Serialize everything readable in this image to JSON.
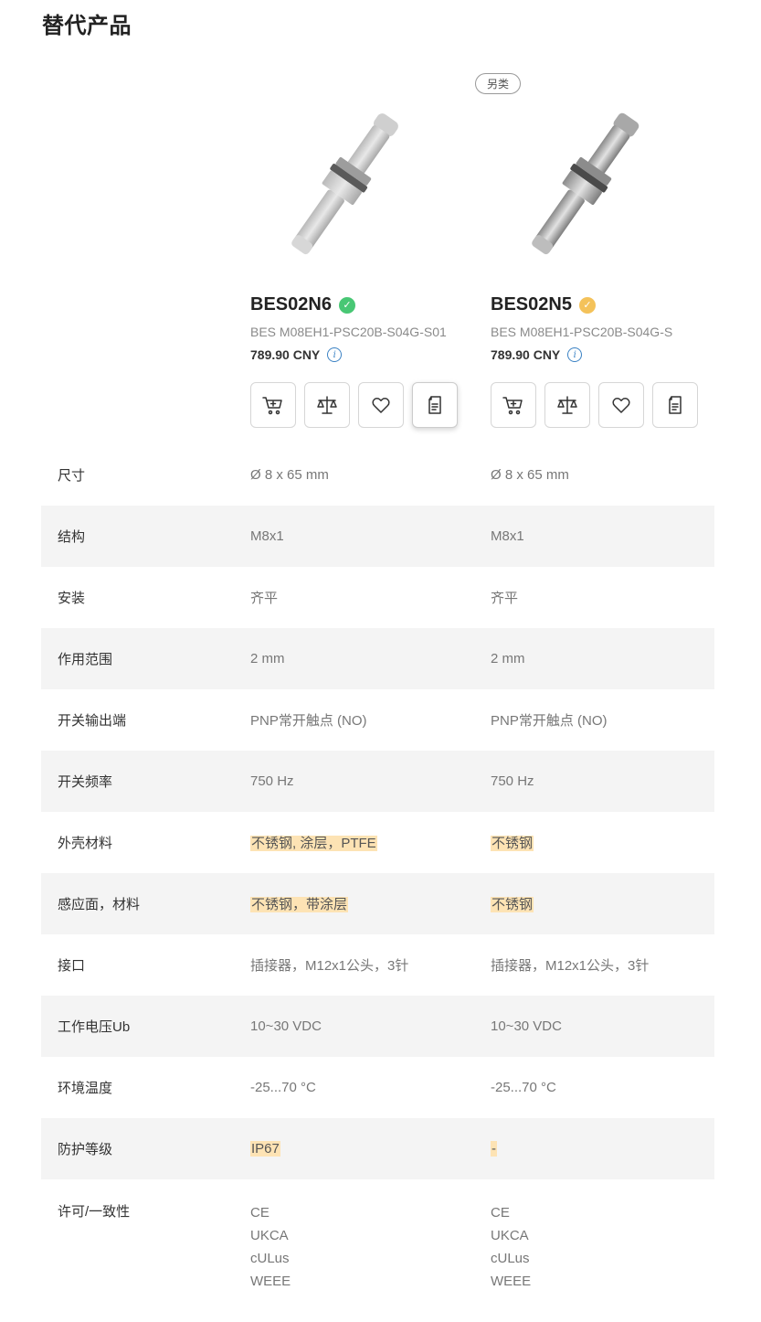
{
  "section_title": "替代产品",
  "products": [
    {
      "badge": "",
      "name": "BES02N6",
      "code": "BES M08EH1-PSC20B-S04G-S01",
      "price": "789.90 CNY",
      "check_color": "green"
    },
    {
      "badge": "另类",
      "name": "BES02N5",
      "code": "BES M08EH1-PSC20B-S04G-S",
      "price": "789.90 CNY",
      "check_color": "amber"
    }
  ],
  "icons": {
    "check": "check-circle-icon",
    "info": "info-icon",
    "cart": "cart-icon",
    "compare": "scale-icon",
    "favorite": "heart-icon",
    "datasheet": "document-icon"
  },
  "colors": {
    "highlight": "#fde3b4",
    "row_alt": "#f4f4f4",
    "check_green": "#48c774",
    "check_amber": "#f4c25a",
    "info_blue": "#3b82c4"
  },
  "specs": [
    {
      "label": "尺寸",
      "v1": "Ø 8 x 65 mm",
      "v2": "Ø 8 x 65 mm"
    },
    {
      "label": "结构",
      "v1": "M8x1",
      "v2": "M8x1"
    },
    {
      "label": "安装",
      "v1": "齐平",
      "v2": "齐平"
    },
    {
      "label": "作用范围",
      "v1": "2 mm",
      "v2": "2 mm"
    },
    {
      "label": "开关输出端",
      "v1": "PNP常开触点 (NO)",
      "v2": "PNP常开触点 (NO)"
    },
    {
      "label": "开关频率",
      "v1": "750 Hz",
      "v2": "750 Hz"
    },
    {
      "label": "外壳材料",
      "v1": "不锈钢, 涂层，PTFE",
      "v2": "不锈钢"
    },
    {
      "label": "感应面，材料",
      "v1": "不锈钢，带涂层",
      "v2": "不锈钢"
    },
    {
      "label": "接口",
      "v1": "插接器，M12x1公头，3针",
      "v2": "插接器，M12x1公头，3针"
    },
    {
      "label": "工作电压Ub",
      "v1": "10~30 VDC",
      "v2": "10~30 VDC"
    },
    {
      "label": "环境温度",
      "v1": "-25...70 °C",
      "v2": "-25...70 °C"
    },
    {
      "label": "防护等级",
      "v1": "IP67",
      "v2": "-"
    },
    {
      "label": "许可/一致性",
      "v1": [
        "CE",
        "UKCA",
        "cULus",
        "WEEE"
      ],
      "v2": [
        "CE",
        "UKCA",
        "cULus",
        "WEEE"
      ]
    }
  ]
}
